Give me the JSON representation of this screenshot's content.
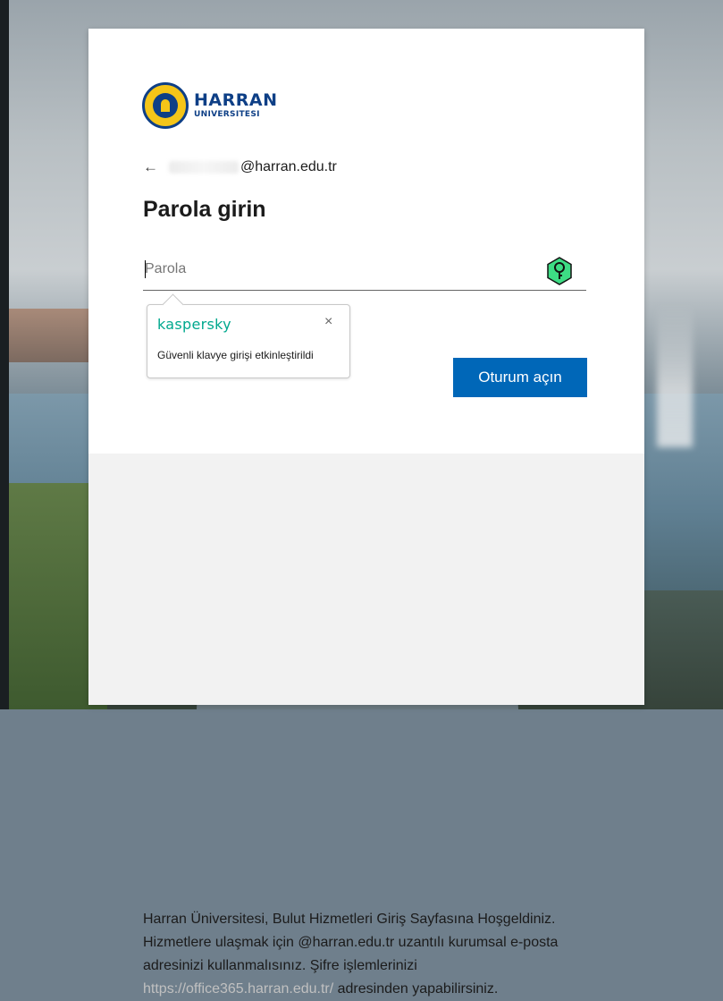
{
  "logo": {
    "line1": "HARRAN",
    "line2": "UNIVERSITESI"
  },
  "identity": {
    "back_icon": "arrow-left-icon",
    "back_glyph": "←",
    "email_domain": "@harran.edu.tr"
  },
  "title": "Parola girin",
  "password": {
    "placeholder": "Parola",
    "value": "",
    "key_icon": "kaspersky-key-icon"
  },
  "kaspersky_popup": {
    "brand": "kaspersky",
    "close_glyph": "×",
    "message": "Güvenli klavye girişi etkinleştirildi"
  },
  "submit_label": "Oturum açın",
  "info": {
    "text_before_link": "Harran Üniversitesi, Bulut Hizmetleri Giriş Sayfasına Hoşgeldiniz. Hizmetlere ulaşmak için @harran.edu.tr uzantılı kurumsal e-posta adresinizi kullanmalısınız. Şifre işlemlerinizi ",
    "link_text": "https://office365.harran.edu.tr/",
    "text_after_link": " adresinden yapabilirsiniz."
  },
  "colors": {
    "primary_button": "#0067b8",
    "kaspersky_green": "#00a88e",
    "logo_blue": "#0e3f86",
    "logo_yellow": "#f5c518"
  }
}
